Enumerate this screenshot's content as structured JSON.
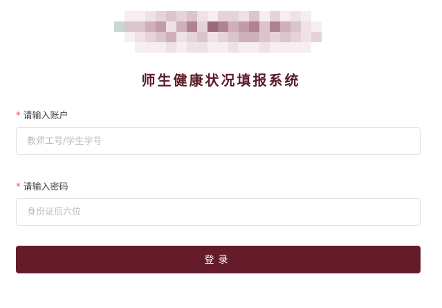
{
  "header": {
    "title": "师生健康状况填报系统"
  },
  "logo": {
    "description_icon": "pixelated-logo-image"
  },
  "form": {
    "account": {
      "required_mark": "*",
      "label": "请输入账户",
      "value": "",
      "placeholder": "教师工号/学生学号"
    },
    "password": {
      "required_mark": "*",
      "label": "请输入密码",
      "value": "",
      "placeholder": "身份证后六位"
    },
    "login_label": "登录"
  },
  "colors": {
    "brand": "#641c2a",
    "title": "#5c1b27",
    "required": "#e05252",
    "input_border": "#dcdfe6",
    "placeholder": "#b8bcc4"
  }
}
